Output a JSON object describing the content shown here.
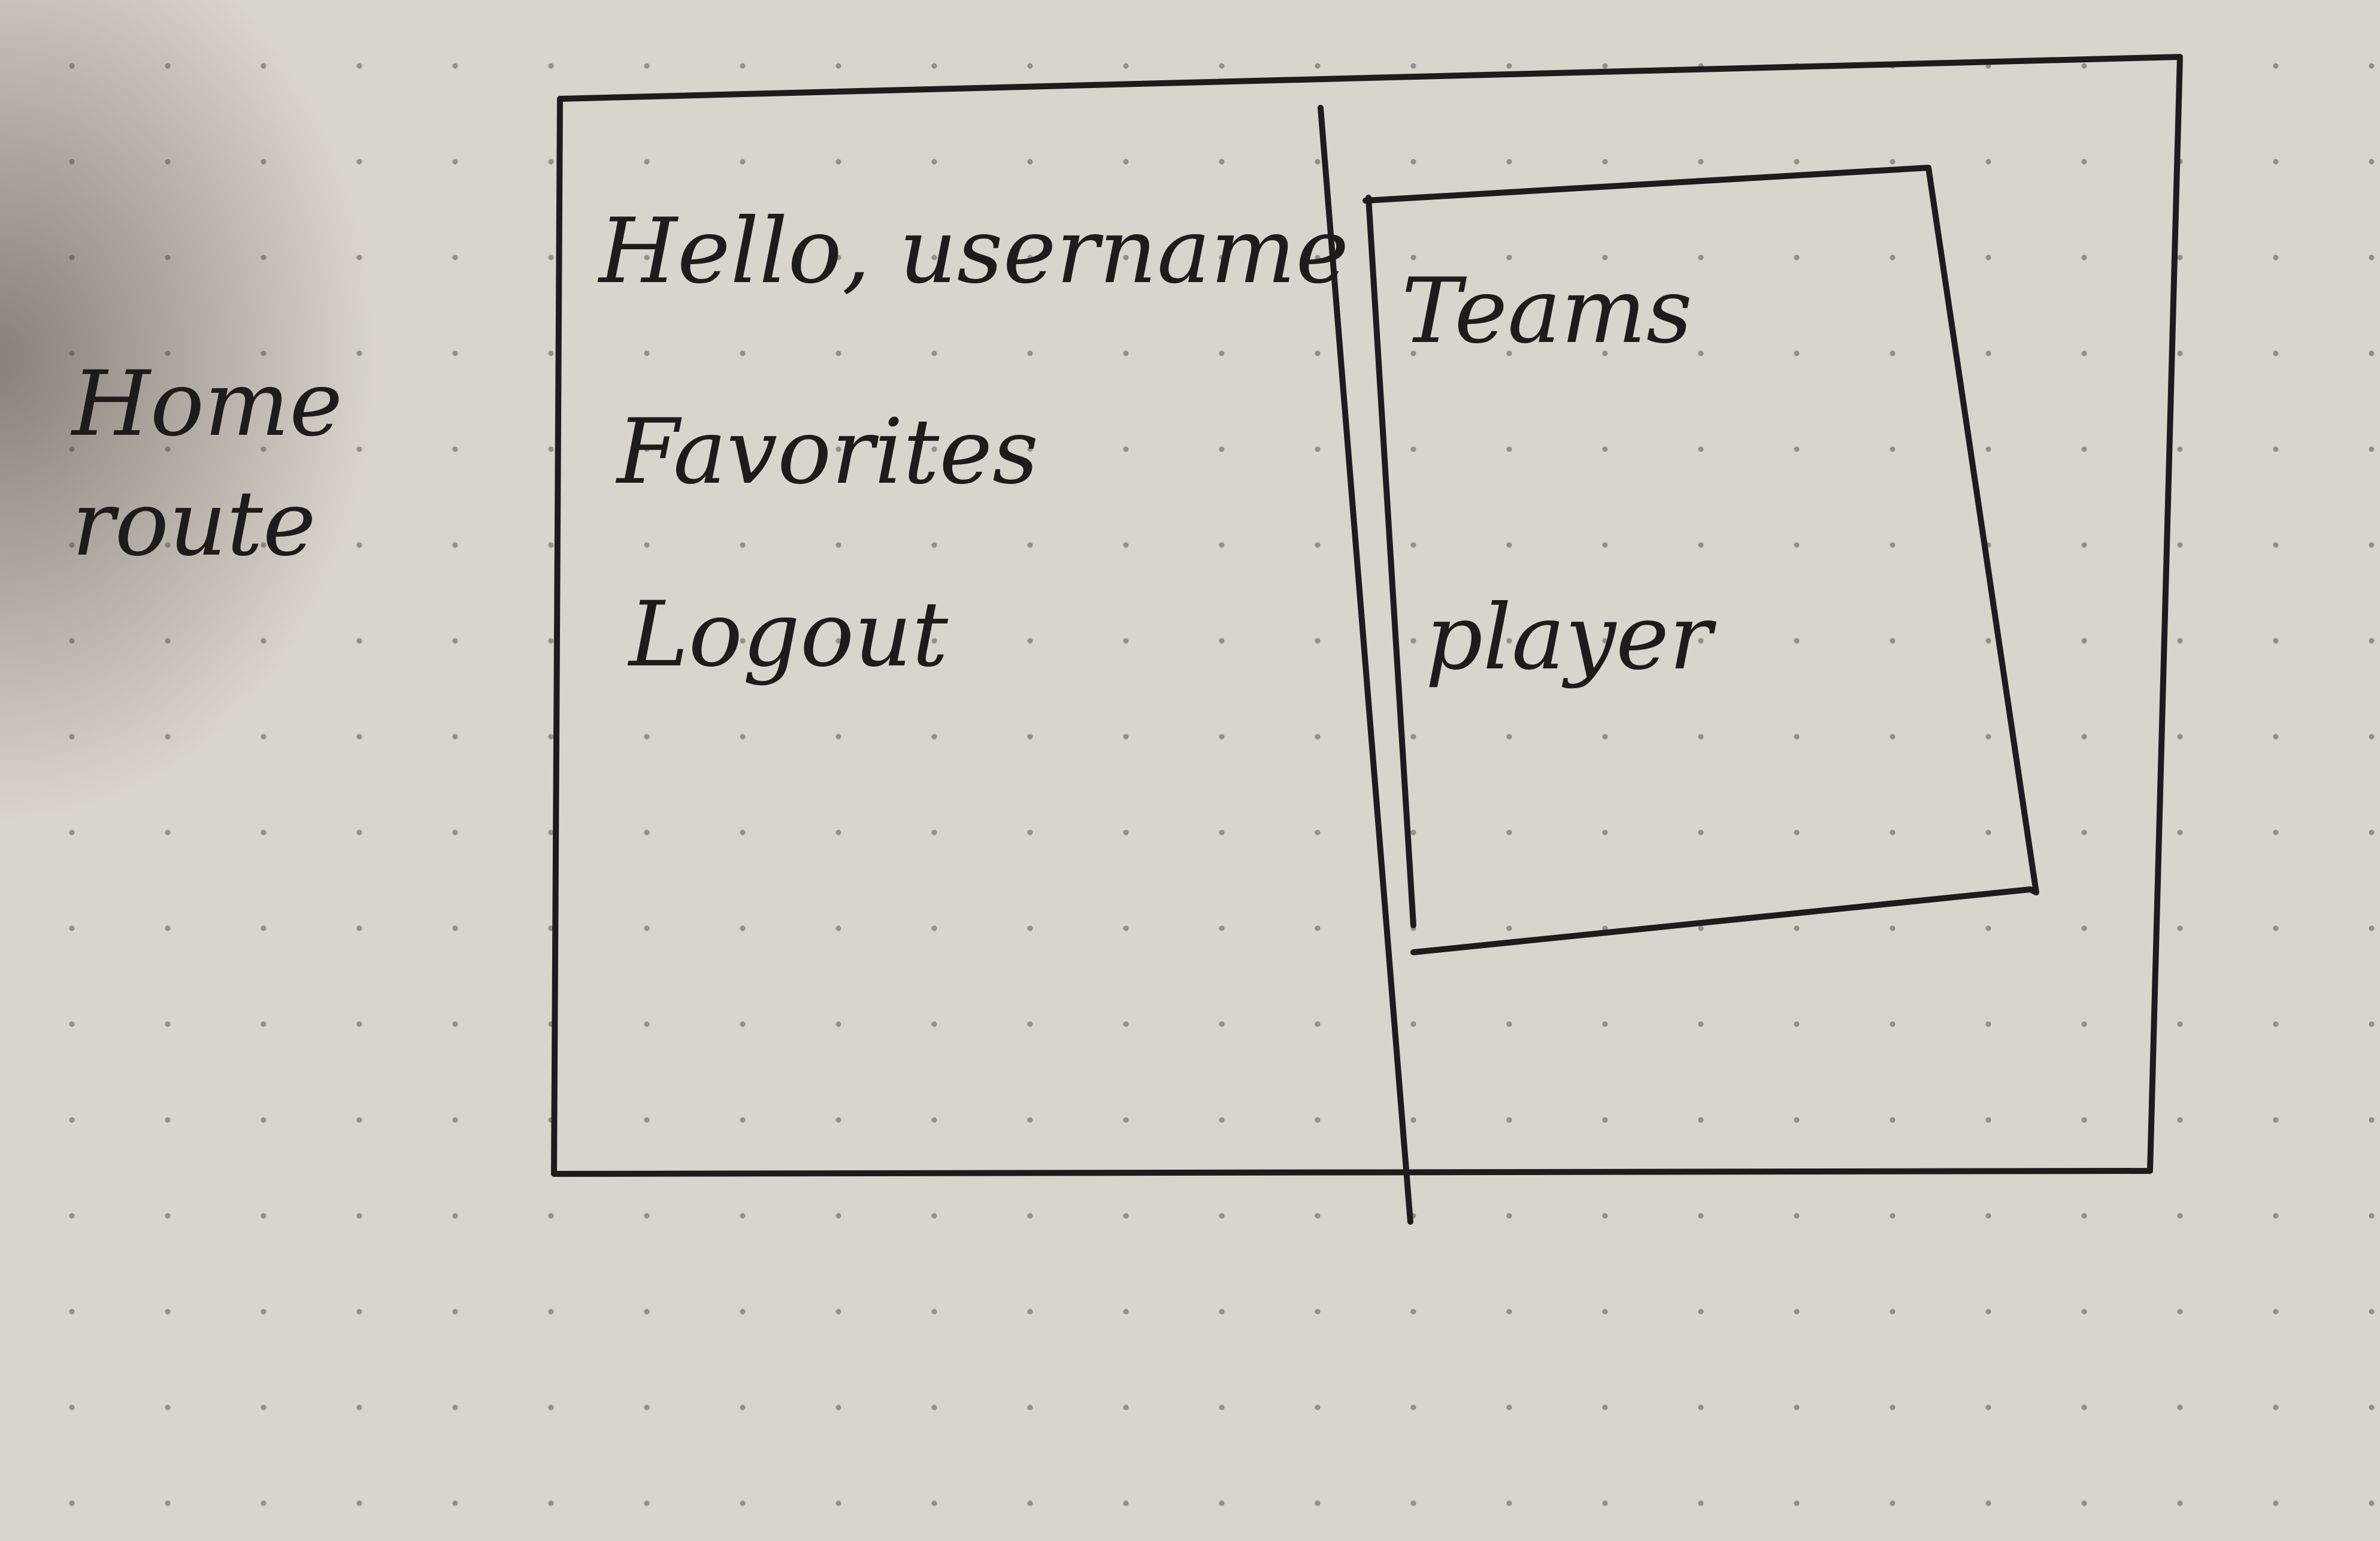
{
  "annotation": {
    "line1": "Home",
    "line2": "route"
  },
  "left_panel": {
    "greeting": "Hello, username",
    "menu": [
      "Favorites",
      "Logout"
    ]
  },
  "right_panel": {
    "card": {
      "items": [
        "Teams",
        "player"
      ]
    }
  },
  "colors": {
    "paper": "#d9d4cc",
    "ink": "#1f1a1c",
    "dots": "#5a5550"
  }
}
